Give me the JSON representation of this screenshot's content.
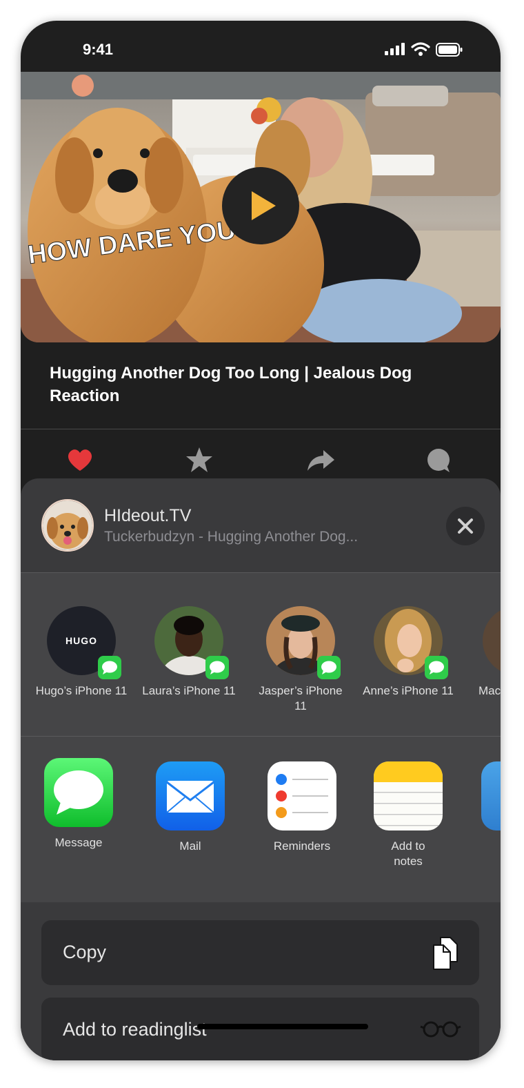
{
  "status_bar": {
    "time": "9:41"
  },
  "video": {
    "overlay_text": "HOW DARE YOU",
    "title": "Hugging Another Dog Too Long | Jealous Dog Reaction"
  },
  "actions": [
    {
      "name": "like",
      "icon": "heart-icon",
      "color": "#e5383b"
    },
    {
      "name": "favorite",
      "icon": "star-icon",
      "color": "#9a9a9a"
    },
    {
      "name": "share",
      "icon": "share-arrow-icon",
      "color": "#9a9a9a"
    },
    {
      "name": "comment",
      "icon": "comment-bubble-icon",
      "color": "#9a9a9a"
    }
  ],
  "share_sheet": {
    "title": "HIdeout.TV",
    "subtitle": "Tuckerbudzyn - Hugging Another Dog...",
    "contacts": [
      {
        "name": "Hugo’s iPhone 11",
        "avatar_text": "HUGO"
      },
      {
        "name": "Laura’s iPhone 11"
      },
      {
        "name": "Jasper’s iPhone 11"
      },
      {
        "name": "Anne’s iPhone 11"
      },
      {
        "name": "Mac"
      }
    ],
    "apps": [
      {
        "name": "Message",
        "icon": "messages-app-icon"
      },
      {
        "name": "Mail",
        "icon": "mail-app-icon"
      },
      {
        "name": "Reminders",
        "icon": "reminders-app-icon"
      },
      {
        "name": "Add to notes",
        "icon": "notes-app-icon"
      },
      {
        "name": "",
        "icon": "partial-app-icon"
      }
    ],
    "rows": [
      {
        "label": "Copy",
        "icon": "copy-icon"
      },
      {
        "label": "Add to readinglist",
        "icon": "glasses-icon"
      }
    ]
  }
}
